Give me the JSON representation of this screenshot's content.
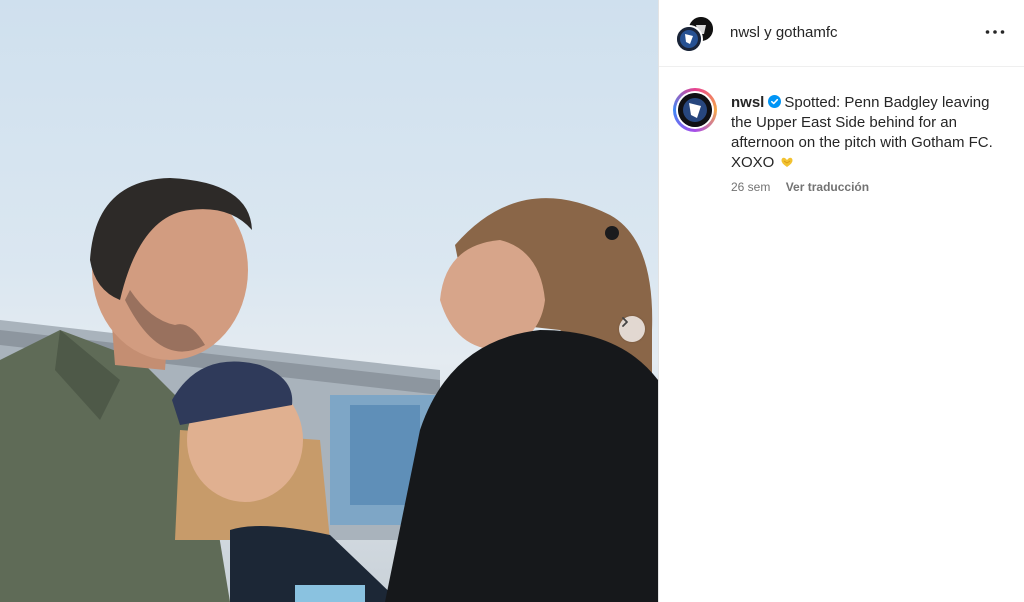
{
  "header": {
    "title": "nwsl y gothamfc"
  },
  "caption": {
    "username": "nwsl",
    "text": "Spotted: Penn Badgley leaving the Upper East Side behind for an afternoon on the pitch with Gotham FC. XOXO",
    "time": "26 sem",
    "translate": "Ver traducción"
  },
  "icons": {
    "more": "more-options-icon",
    "verified": "verified-badge-icon",
    "next": "chevron-right-icon",
    "emoji": "heart-hands-emoji"
  },
  "colors": {
    "verified": "#0095f6",
    "meta": "#737373",
    "text": "#262626"
  }
}
